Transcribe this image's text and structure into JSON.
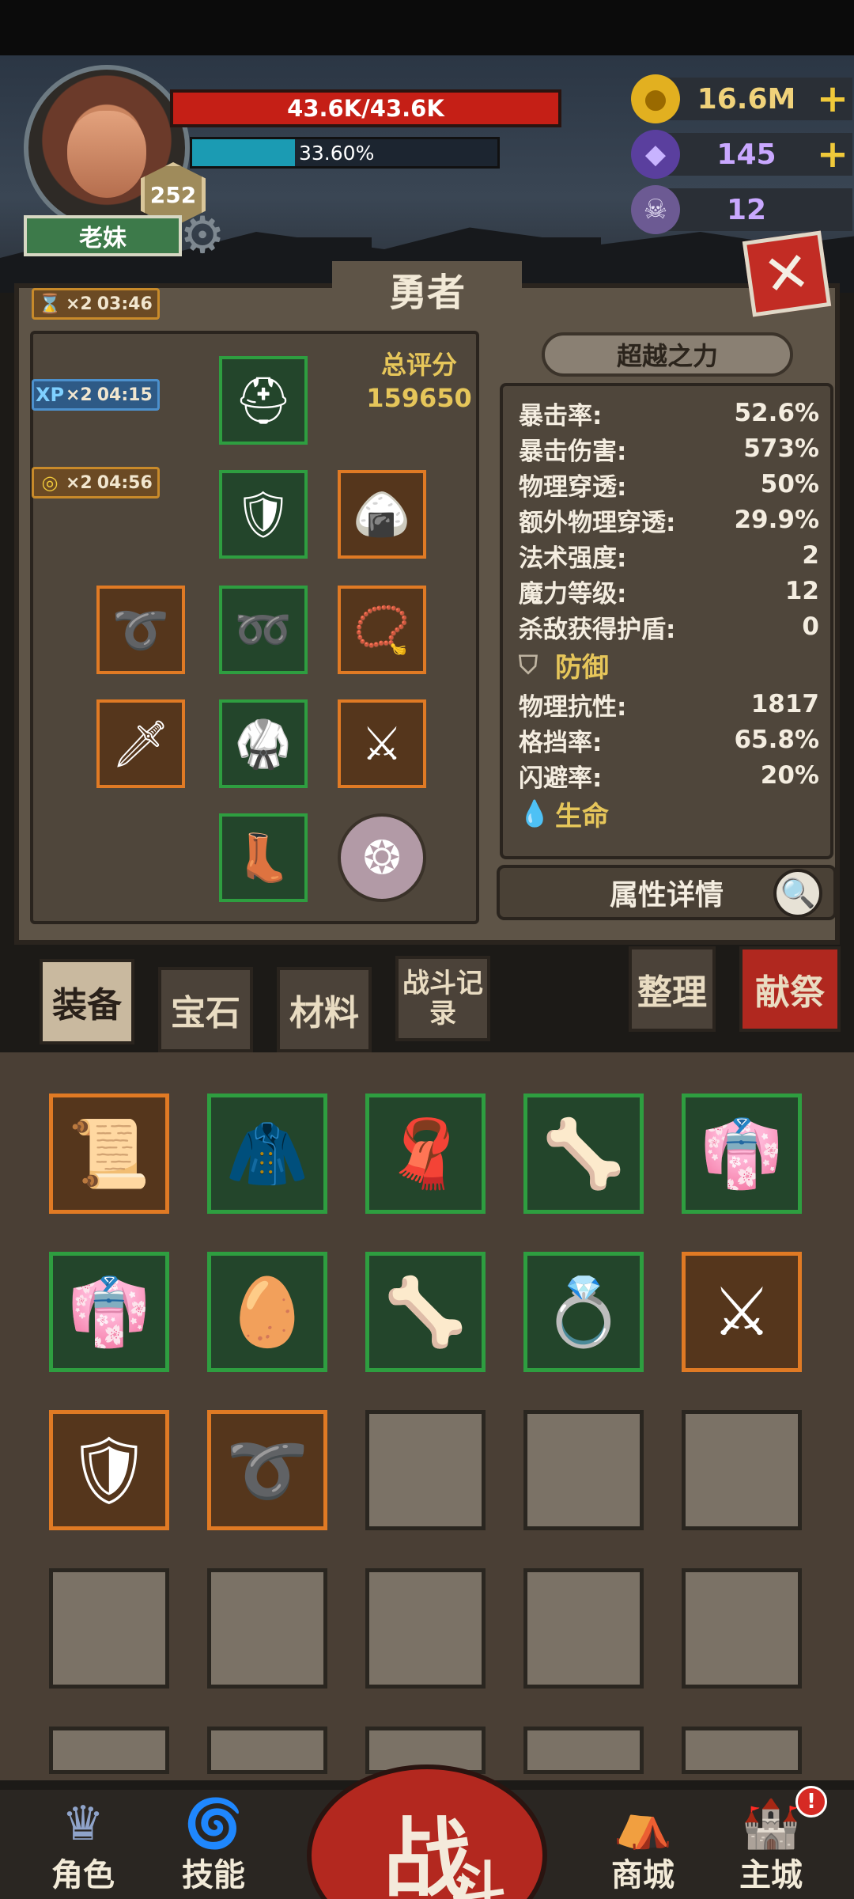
{
  "player": {
    "name": "老妹",
    "level": "252",
    "hp": "43.6K/43.6K",
    "xp_percent_text": "33.60%",
    "xp_fraction": 0.336
  },
  "currencies": {
    "gold": "16.6M",
    "crystal": "145",
    "ram": "12"
  },
  "panel": {
    "title": "勇者",
    "score_label": "总评分",
    "score_value": "159650",
    "transcend_label": "超越之力",
    "details_label": "属性详情"
  },
  "buffs": [
    {
      "icon": "hourglass-icon",
      "multiplier": "×2",
      "timer": "03:46"
    },
    {
      "icon": "xp-icon",
      "label": "XP",
      "multiplier": "×2",
      "timer": "04:15"
    },
    {
      "icon": "coin-icon",
      "multiplier": "×2",
      "timer": "04:56"
    }
  ],
  "stats": {
    "attack": [
      {
        "label": "暴击率:",
        "value": "52.6%"
      },
      {
        "label": "暴击伤害:",
        "value": "573%"
      },
      {
        "label": "物理穿透:",
        "value": "50%"
      },
      {
        "label": "额外物理穿透:",
        "value": "29.9%"
      },
      {
        "label": "法术强度:",
        "value": "2"
      },
      {
        "label": "魔力等级:",
        "value": "12"
      },
      {
        "label": "杀敌获得护盾:",
        "value": "0"
      }
    ],
    "defense_title": "防御",
    "defense": [
      {
        "label": "物理抗性:",
        "value": "1817"
      },
      {
        "label": "格挡率:",
        "value": "65.8%"
      },
      {
        "label": "闪避率:",
        "value": "20%"
      }
    ],
    "life_title": "生命"
  },
  "tabs": {
    "equip": "装备",
    "gem": "宝石",
    "material": "材料",
    "battle_log": "战斗记录",
    "sort": "整理",
    "sacrifice": "献祭"
  },
  "nav": {
    "character": "角色",
    "skill": "技能",
    "battle_main": "战",
    "battle_sub": "斗",
    "shop": "商城",
    "city": "主城",
    "alert": "!"
  },
  "colors": {
    "hp": "#c51f16",
    "xp": "#1b9bb3",
    "gold_text": "#e6c65a",
    "rarity_green": "#2e9e40",
    "rarity_orange": "#e07a24",
    "sacrifice": "#b0281f"
  }
}
